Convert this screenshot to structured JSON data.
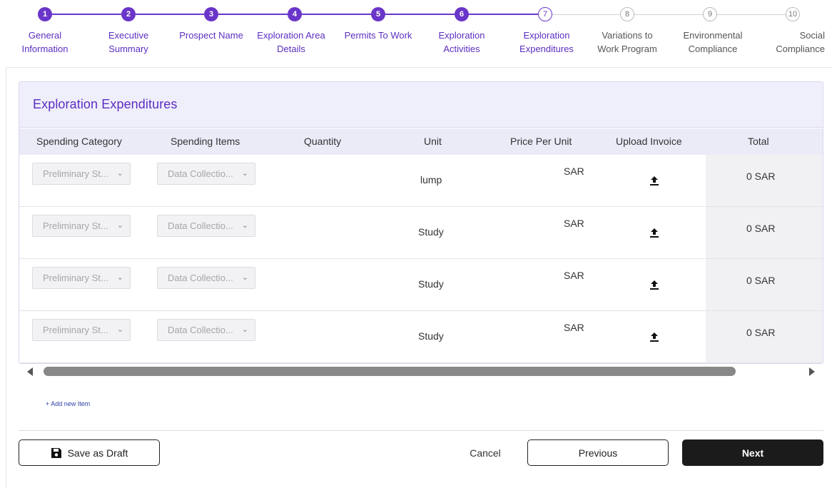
{
  "stepper": {
    "steps": [
      {
        "number": "1",
        "label": "General\nInformation",
        "state": "done"
      },
      {
        "number": "2",
        "label": "Executive\nSummary",
        "state": "done"
      },
      {
        "number": "3",
        "label": "Prospect Name",
        "state": "done"
      },
      {
        "number": "4",
        "label": "Exploration Area\nDetails",
        "state": "done"
      },
      {
        "number": "5",
        "label": "Permits To Work",
        "state": "done"
      },
      {
        "number": "6",
        "label": "Exploration\nActivities",
        "state": "done"
      },
      {
        "number": "7",
        "label": "Exploration\nExpenditures",
        "state": "current"
      },
      {
        "number": "8",
        "label": "Variations to\nWork Program",
        "state": "todo"
      },
      {
        "number": "9",
        "label": "Environmental\nCompliance",
        "state": "todo"
      },
      {
        "number": "10",
        "label": "Social\nCompliance",
        "state": "todo"
      }
    ]
  },
  "card": {
    "title": "Exploration Expenditures"
  },
  "table": {
    "columns": [
      "Spending Category",
      "Spending Items",
      "Quantity",
      "Unit",
      "Price Per Unit",
      "Upload Invoice",
      "Total"
    ],
    "rows": [
      {
        "category": "Preliminary St...",
        "item": "Data Collectio...",
        "quantity": "",
        "unit": "lump",
        "price": "SAR",
        "total": "0 SAR"
      },
      {
        "category": "Preliminary St...",
        "item": "Data Collectio...",
        "quantity": "",
        "unit": "Study",
        "price": "SAR",
        "total": "0 SAR"
      },
      {
        "category": "Preliminary St...",
        "item": "Data Collectio...",
        "quantity": "",
        "unit": "Study",
        "price": "SAR",
        "total": "0 SAR"
      },
      {
        "category": "Preliminary St...",
        "item": "Data Collectio...",
        "quantity": "",
        "unit": "Study",
        "price": "SAR",
        "total": "0 SAR"
      }
    ]
  },
  "add_item_label": "+ Add new Item",
  "footer": {
    "save_draft_label": "Save as Draft",
    "cancel_label": "Cancel",
    "previous_label": "Previous",
    "next_label": "Next"
  },
  "colors": {
    "accent": "#6a35c9",
    "header_bg": "#efeefb",
    "next_bg": "#1b1b1b"
  },
  "icons": {
    "upload": "upload-icon",
    "save": "floppy-disk-icon",
    "chevron": "chevron-down-icon"
  }
}
